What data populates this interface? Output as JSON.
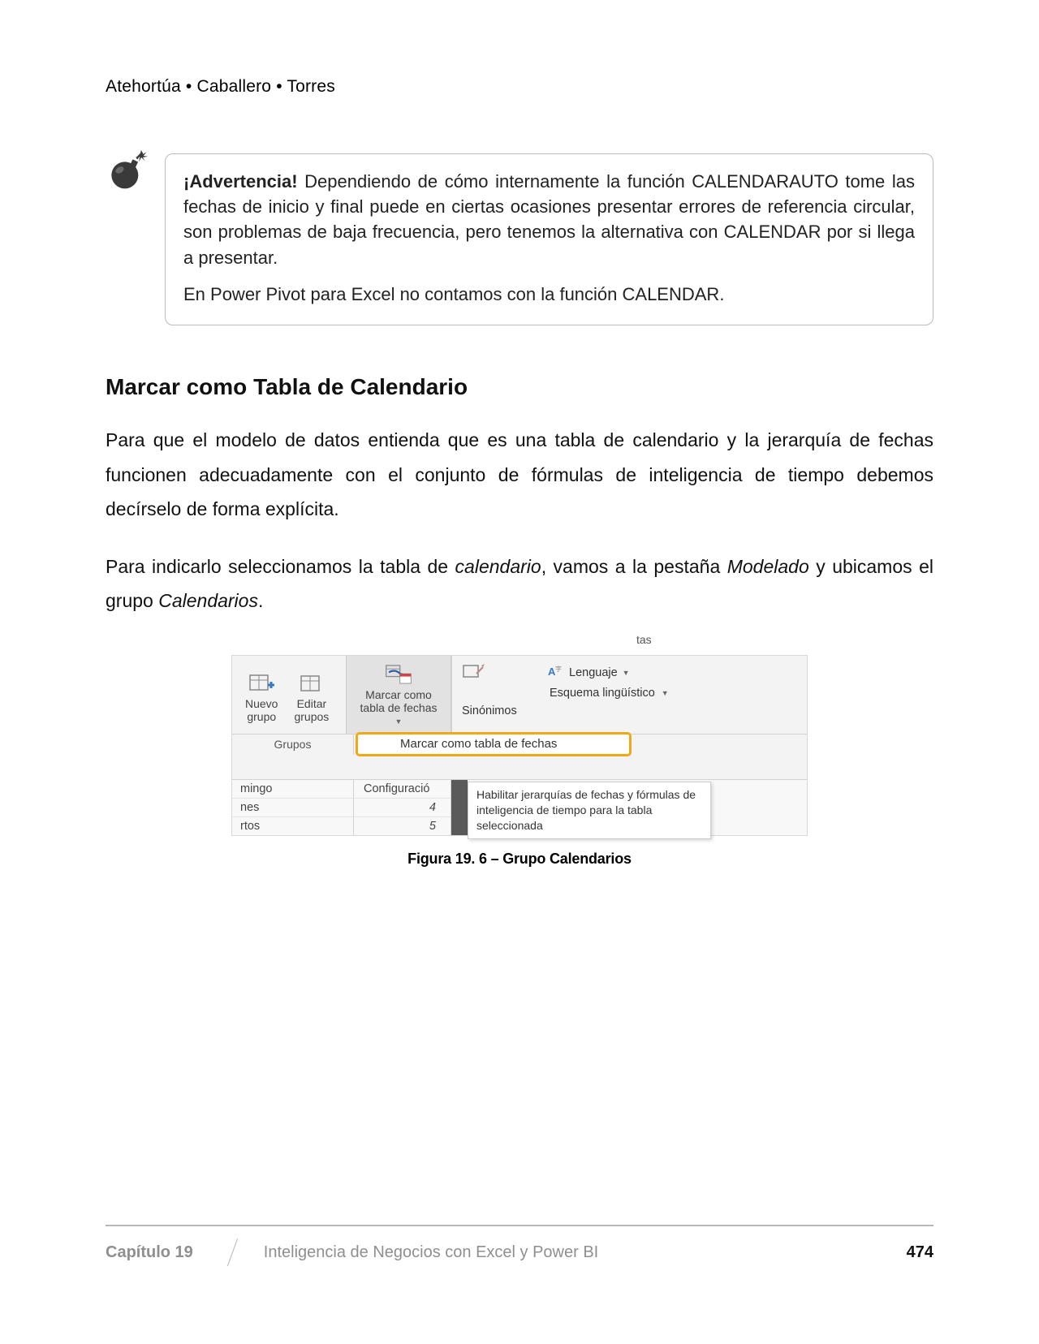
{
  "header": {
    "authors": "Atehortúa • Caballero • Torres"
  },
  "warning": {
    "lead": "¡Advertencia!",
    "p1_rest": " Dependiendo de cómo internamente la función CALENDARAUTO tome las fechas de inicio y final puede en ciertas ocasiones presentar errores de referencia circular, son problemas de baja frecuencia, pero tenemos la alternativa con CALENDAR por si llega a presentar.",
    "p2": "En Power Pivot para Excel no contamos con la función CALENDAR."
  },
  "section": {
    "heading": "Marcar como Tabla de Calendario"
  },
  "para1": "Para que el modelo de datos entienda que es una tabla de calendario y la jerarquía de fechas funcionen adecuadamente con el conjunto de fórmulas de inteligencia de tiempo debemos decírselo de forma explícita.",
  "para2_a": "Para indicarlo seleccionamos la tabla de ",
  "para2_i1": "calendario",
  "para2_b": ", vamos a la pestaña ",
  "para2_i2": "Modelado",
  "para2_c": " y ubicamos el grupo ",
  "para2_i3": "Calendarios",
  "para2_d": ".",
  "ribbon": {
    "nuevo_grupo": "Nuevo grupo",
    "editar_grupos": "Editar grupos",
    "grupos_label": "Grupos",
    "marcar_como": "Marcar como tabla de fechas",
    "sinonimos": "Sinónimos",
    "lenguaje": "Lenguaje",
    "esquema": "Esquema lingüístico",
    "highlight": "Marcar como tabla de fechas",
    "configuracio": "Configuració",
    "tas": "tas",
    "mingo": "mingo",
    "nes": "nes",
    "rtoc": "rtos",
    "num4": "4",
    "num5": "5",
    "tooltip": "Habilitar jerarquías de fechas y fórmulas de inteligencia de tiempo para la tabla seleccionada"
  },
  "caption": "Figura 19. 6 – Grupo Calendarios",
  "footer": {
    "chapter": "Capítulo 19",
    "title": "Inteligencia de Negocios con Excel y Power BI",
    "page": "474"
  }
}
